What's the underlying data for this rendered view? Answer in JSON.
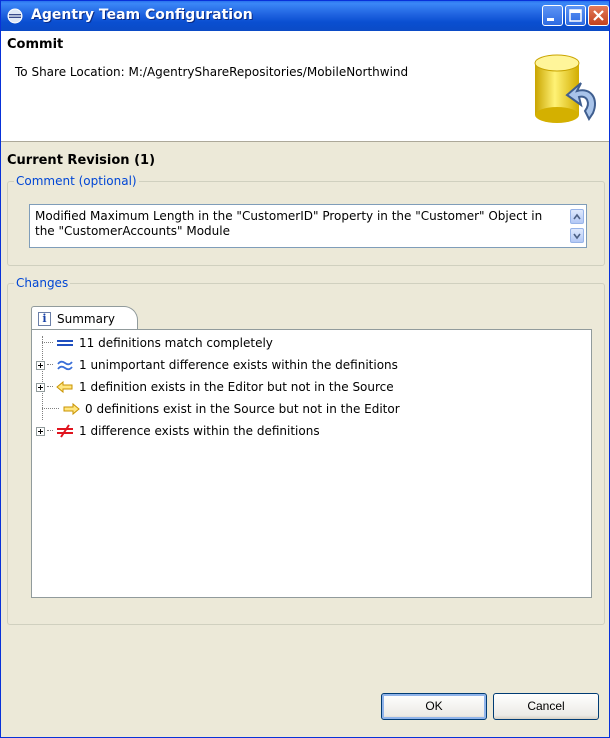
{
  "window": {
    "title": "Agentry Team Configuration"
  },
  "header": {
    "title": "Commit",
    "description": "To Share Location: M:/AgentryShareRepositories/MobileNorthwind"
  },
  "revision": {
    "title": "Current Revision (1)"
  },
  "comment_group": {
    "legend": "Comment (optional)",
    "text": "Modified Maximum Length in the \"CustomerID\" Property in the \"Customer\" Object in the \"CustomerAccounts\" Module"
  },
  "changes_group": {
    "legend": "Changes",
    "tab_label": "Summary",
    "items": [
      {
        "label": "11 definitions match completely",
        "icon": "equals-icon",
        "expandable": false
      },
      {
        "label": "1 unimportant difference exists within the definitions",
        "icon": "approx-icon",
        "expandable": true
      },
      {
        "label": "1 definition exists in the Editor but not in the Source",
        "icon": "arrow-left-icon",
        "expandable": true
      },
      {
        "label": "0 definitions exist in the Source but not in the Editor",
        "icon": "arrow-right-icon",
        "expandable": false
      },
      {
        "label": "1 difference exists within the definitions",
        "icon": "not-equal-icon",
        "expandable": true
      }
    ]
  },
  "buttons": {
    "ok": "OK",
    "cancel": "Cancel"
  },
  "colors": {
    "title_bar": "#0a4fd1",
    "group_legend": "#0046d5",
    "window_bg": "#ece9d8"
  }
}
